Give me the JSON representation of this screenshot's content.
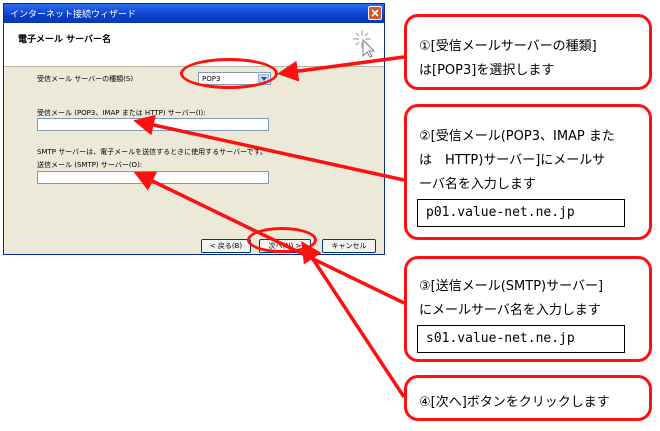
{
  "window": {
    "title": "インターネット接続ウィザード",
    "page_title": "電子メール サーバー名"
  },
  "form": {
    "incoming_type_label": "受信メール サーバーの種類(S)",
    "incoming_type_value": "POP3",
    "incoming_server_label": "受信メール (POP3、IMAP または HTTP) サーバー(I):",
    "smtp_note": "SMTP サーバーは、電子メールを送信するときに使用するサーバーです。",
    "outgoing_server_label": "送信メール (SMTP) サーバー(O):"
  },
  "buttons": {
    "back": "< 戻る(B)",
    "next": "次へ(N) >",
    "cancel": "キャンセル"
  },
  "callouts": {
    "c1": {
      "line1": "①[受信メールサーバーの種類]",
      "line2": "は[POP3]を選択します"
    },
    "c2": {
      "line1": "②[受信メール(POP3、IMAP また",
      "line2": "は　HTTP)サーバー]にメールサ",
      "line3": "ーバ名を入力します",
      "code": "p01.value-net.ne.jp"
    },
    "c3": {
      "line1": "③[送信メール(SMTP)サーバー]",
      "line2": "にメールサーバ名を入力します",
      "code": "s01.value-net.ne.jp"
    },
    "c4": {
      "line1": "④[次へ]ボタンをクリックします"
    }
  },
  "colors": {
    "annotation_red": "#ff1010",
    "titlebar_blue": "#0a3fc8",
    "dialog_bg": "#ece9d8"
  }
}
